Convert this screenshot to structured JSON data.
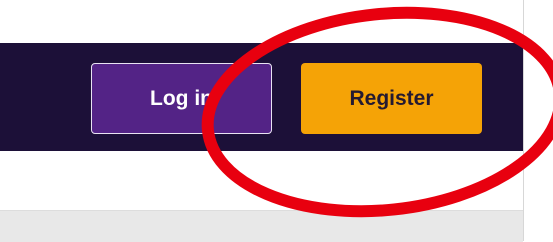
{
  "header": {
    "login_label": "Log in",
    "register_label": "Register"
  },
  "colors": {
    "header_background": "#1c1038",
    "login_button": "#532386",
    "register_button": "#f5a306",
    "annotation_circle": "#e8000f"
  }
}
